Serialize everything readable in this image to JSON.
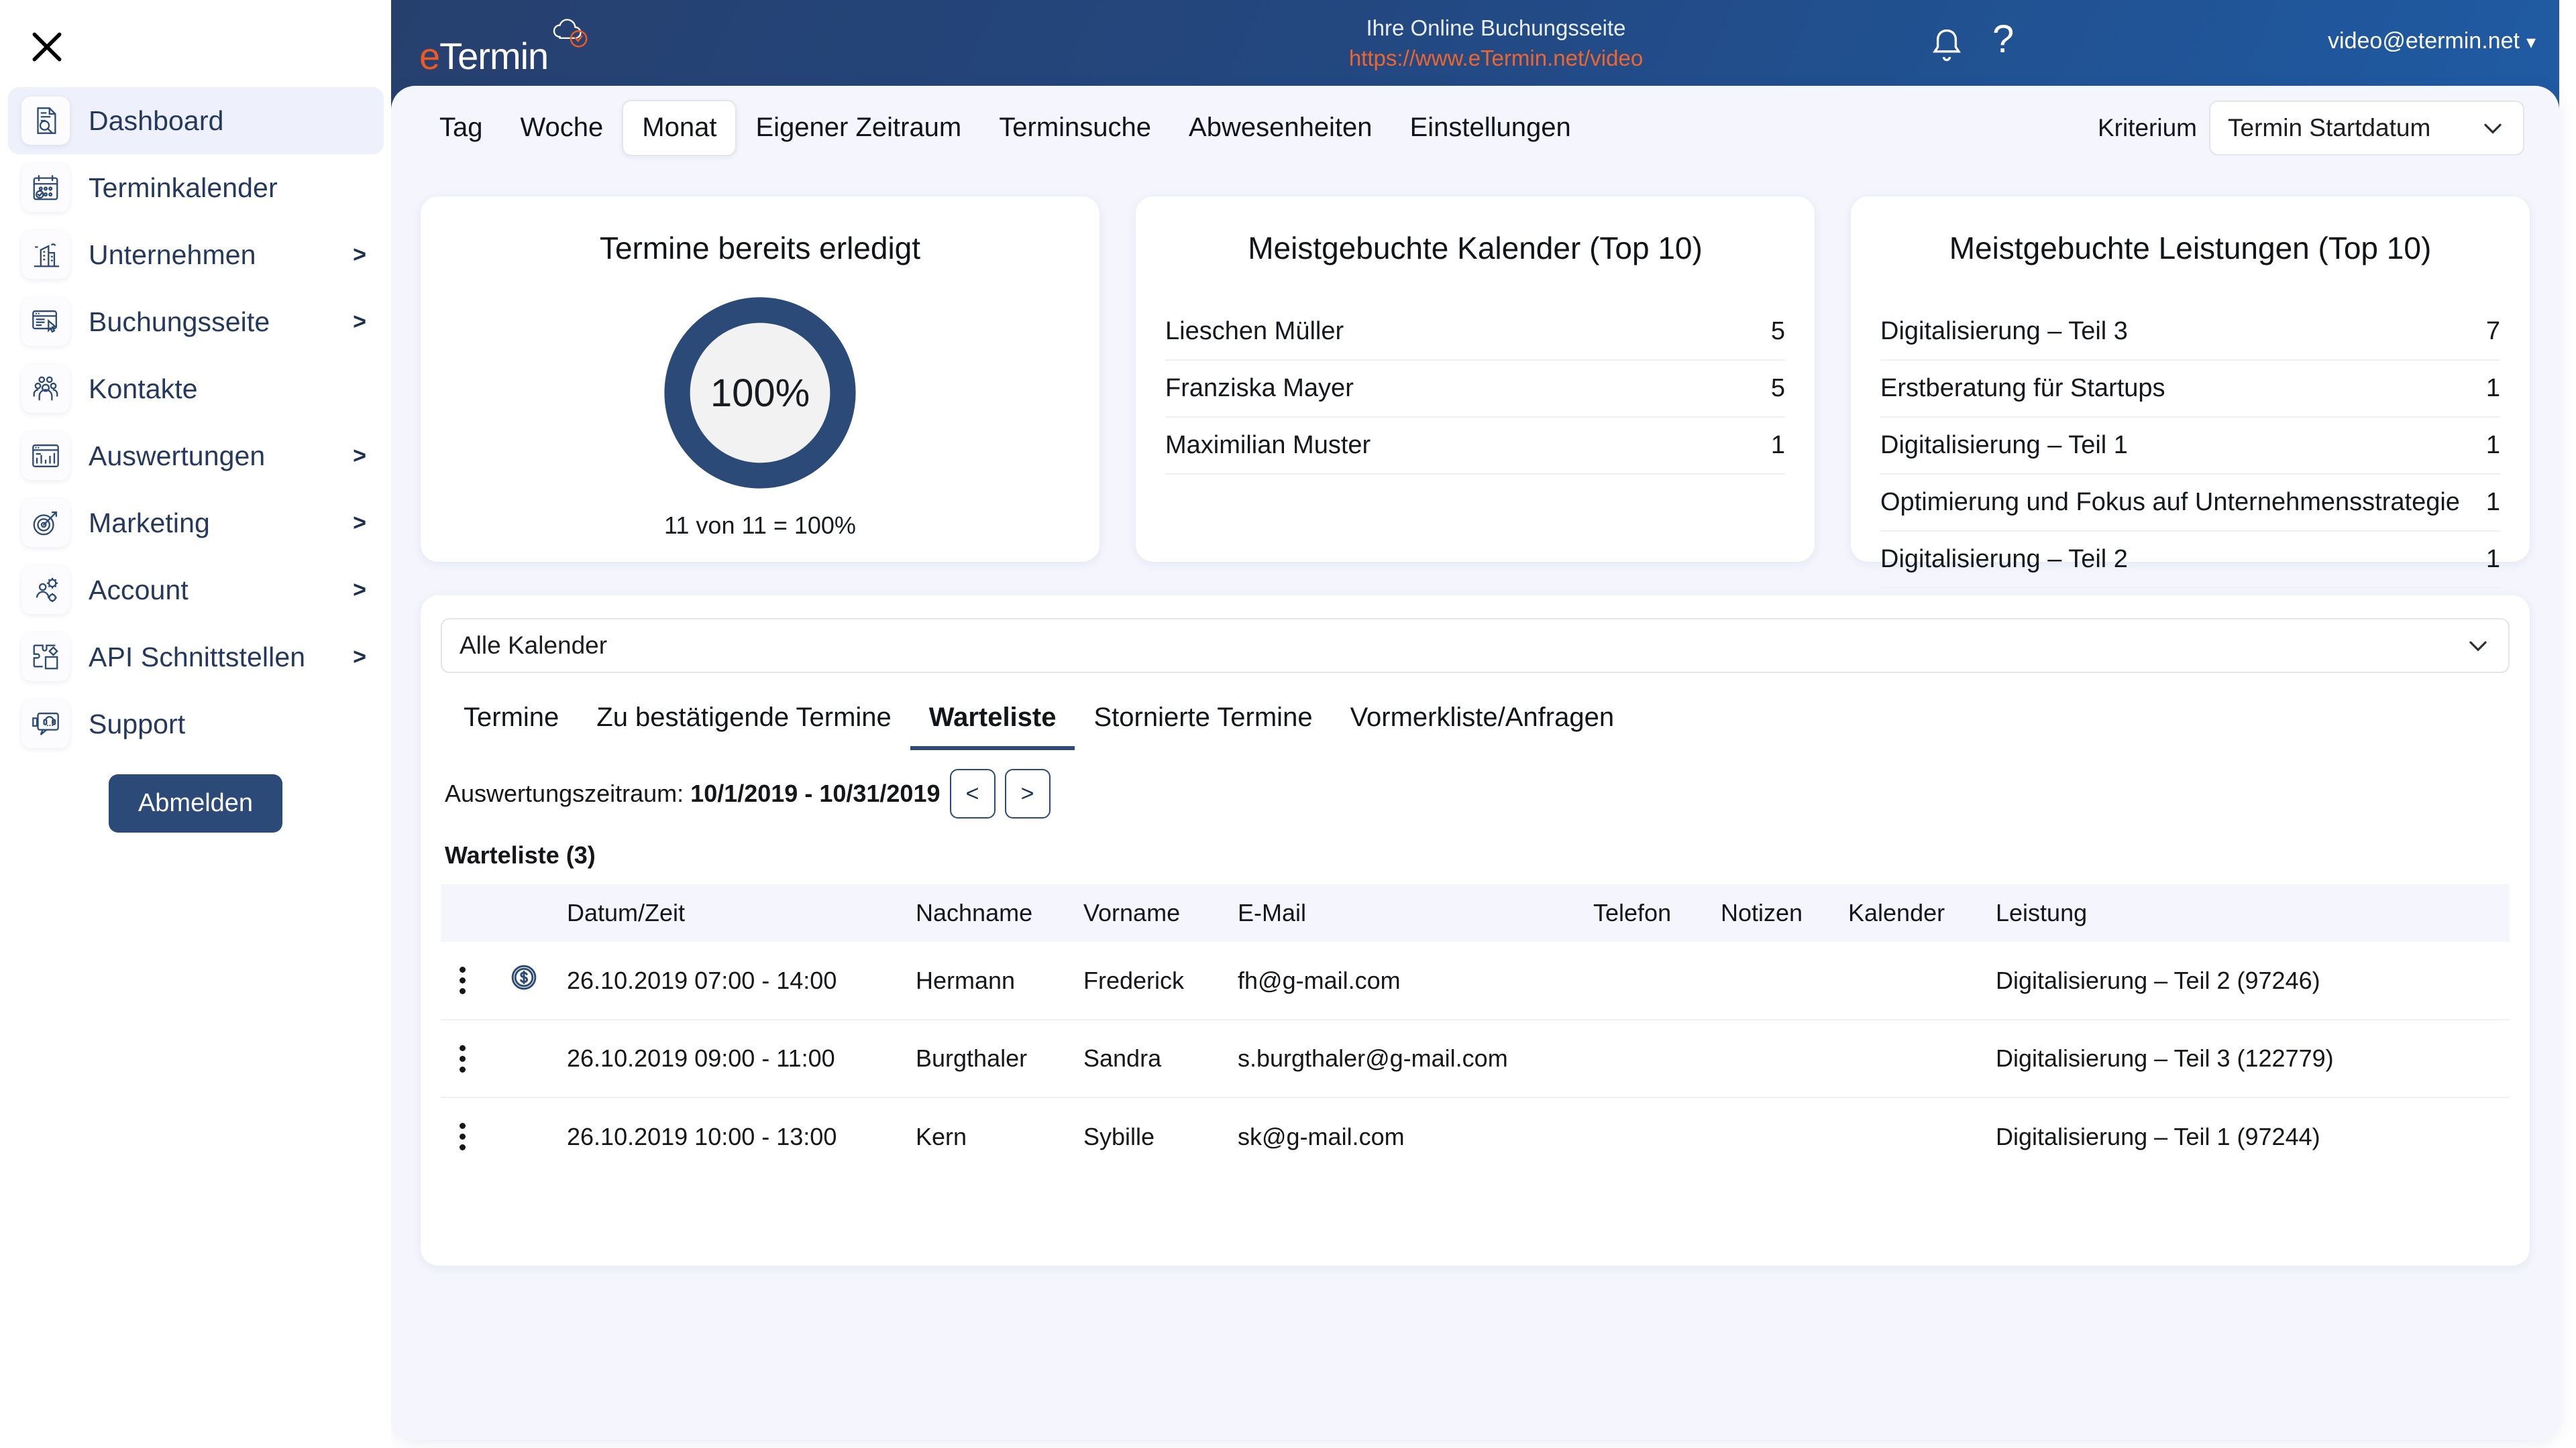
{
  "sidebar": {
    "close_icon": "close-icon",
    "items": [
      {
        "label": "Dashboard",
        "icon": "document-search-icon",
        "chevron": "",
        "active": true
      },
      {
        "label": "Terminkalender",
        "icon": "calendar-check-icon",
        "chevron": "",
        "active": false
      },
      {
        "label": "Unternehmen",
        "icon": "building-icon",
        "chevron": ">",
        "active": false
      },
      {
        "label": "Buchungsseite",
        "icon": "webpage-click-icon",
        "chevron": ">",
        "active": false
      },
      {
        "label": "Kontakte",
        "icon": "people-icon",
        "chevron": "",
        "active": false
      },
      {
        "label": "Auswertungen",
        "icon": "bar-chart-icon",
        "chevron": ">",
        "active": false
      },
      {
        "label": "Marketing",
        "icon": "target-arrow-icon",
        "chevron": ">",
        "active": false
      },
      {
        "label": "Account",
        "icon": "user-gears-icon",
        "chevron": ">",
        "active": false
      },
      {
        "label": "API Schnittstellen",
        "icon": "puzzle-icon",
        "chevron": ">",
        "active": false
      },
      {
        "label": "Support",
        "icon": "headset-chat-icon",
        "chevron": "",
        "active": false
      }
    ],
    "logout_label": "Abmelden"
  },
  "header": {
    "logo_e": "e",
    "logo_rest": "Termin",
    "booking_caption": "Ihre Online Buchungsseite",
    "booking_url": "https://www.eTermin.net/video",
    "bell_icon": "bell-icon",
    "help_icon": "question-mark-icon",
    "user_email": "video@etermin.net",
    "user_caret": "⌄",
    "brand_blue": "#24477f",
    "brand_orange": "#ef5a21"
  },
  "viewtabs": {
    "items": [
      {
        "label": "Tag",
        "active": false
      },
      {
        "label": "Woche",
        "active": false
      },
      {
        "label": "Monat",
        "active": true
      },
      {
        "label": "Eigener Zeitraum",
        "active": false
      },
      {
        "label": "Terminsuche",
        "active": false
      },
      {
        "label": "Abwesenheiten",
        "active": false
      },
      {
        "label": "Einstellungen",
        "active": false
      }
    ],
    "kriterium_label": "Kriterium",
    "kriterium_value": "Termin Startdatum"
  },
  "cards": {
    "done": {
      "title": "Termine bereits erledigt",
      "percent_label": "100%",
      "sub": "11 von 11 = 100%",
      "ring_color": "#2b4a77",
      "inner_color": "#f2f2f2"
    },
    "calendars": {
      "title": "Meistgebuchte Kalender (Top 10)",
      "rows": [
        {
          "name": "Lieschen Müller",
          "value": "5"
        },
        {
          "name": "Franziska Mayer",
          "value": "5"
        },
        {
          "name": "Maximilian Muster",
          "value": "1"
        }
      ]
    },
    "services": {
      "title": "Meistgebuchte Leistungen (Top 10)",
      "rows": [
        {
          "name": "Digitalisierung – Teil 3",
          "value": "7"
        },
        {
          "name": "Erstberatung für Startups",
          "value": "1"
        },
        {
          "name": "Digitalisierung – Teil 1",
          "value": "1"
        },
        {
          "name": "Optimierung und Fokus auf Unternehmensstrategie",
          "value": "1"
        },
        {
          "name": "Digitalisierung – Teil 2",
          "value": "1"
        }
      ]
    }
  },
  "chart_data": {
    "type": "pie",
    "title": "Termine bereits erledigt",
    "labels": [
      "erledigt",
      "offen"
    ],
    "values": [
      100,
      0
    ],
    "unit": "%",
    "center_label": "100%",
    "annotation": "11 von 11 = 100%",
    "colors": [
      "#2b4a77",
      "#f2f2f2"
    ],
    "legend": "none",
    "grid": false
  },
  "lower": {
    "calendar_filter": "Alle Kalender",
    "subtabs": [
      {
        "label": "Termine",
        "active": false
      },
      {
        "label": "Zu bestätigende Termine",
        "active": false
      },
      {
        "label": "Warteliste",
        "active": true
      },
      {
        "label": "Stornierte Termine",
        "active": false
      },
      {
        "label": "Vormerkliste/Anfragen",
        "active": false
      }
    ],
    "period_label": "Auswertungszeitraum:",
    "period_value": "10/1/2019 - 10/31/2019",
    "prev_label": "<",
    "next_label": ">",
    "list_title": "Warteliste (3)",
    "columns": [
      "",
      "",
      "Datum/Zeit",
      "Nachname",
      "Vorname",
      "E-Mail",
      "Telefon",
      "Notizen",
      "Kalender",
      "Leistung"
    ],
    "rows": [
      {
        "menu_icon": "three-dots-icon",
        "pay_icon": "dollar-circle-icon",
        "datetime": "26.10.2019 07:00 - 14:00",
        "lastname": "Hermann",
        "firstname": "Frederick",
        "email": "fh@g-mail.com",
        "phone": "",
        "notes": "",
        "calendar": "",
        "service": "Digitalisierung – Teil 2 (97246)"
      },
      {
        "menu_icon": "three-dots-icon",
        "pay_icon": "",
        "datetime": "26.10.2019 09:00 - 11:00",
        "lastname": "Burgthaler",
        "firstname": "Sandra",
        "email": "s.burgthaler@g-mail.com",
        "phone": "",
        "notes": "",
        "calendar": "",
        "service": "Digitalisierung – Teil 3 (122779)"
      },
      {
        "menu_icon": "three-dots-icon",
        "pay_icon": "",
        "datetime": "26.10.2019 10:00 - 13:00",
        "lastname": "Kern",
        "firstname": "Sybille",
        "email": "sk@g-mail.com",
        "phone": "",
        "notes": "",
        "calendar": "",
        "service": "Digitalisierung – Teil 1 (97244)"
      }
    ]
  }
}
